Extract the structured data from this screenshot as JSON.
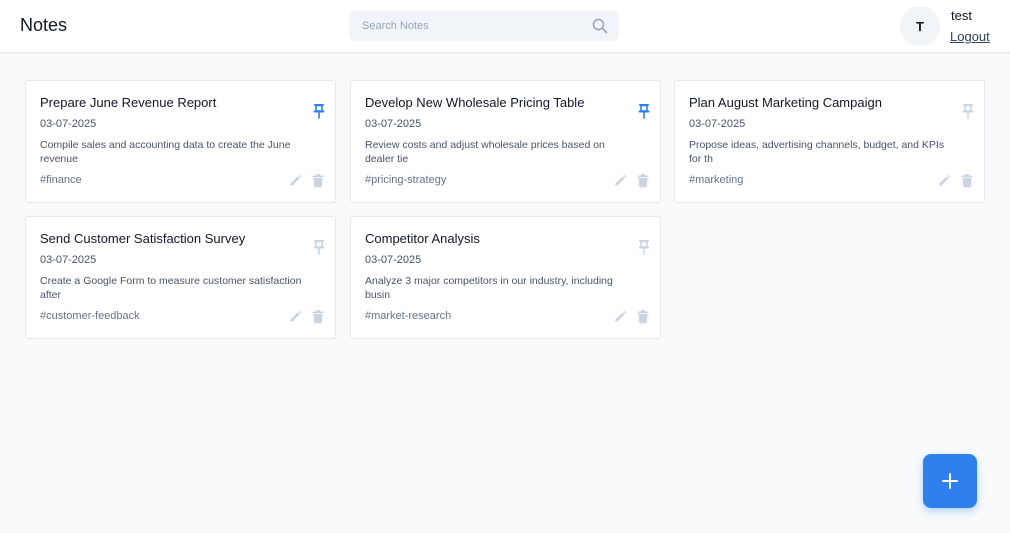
{
  "header": {
    "title": "Notes",
    "search_placeholder": "Search Notes",
    "avatar_initial": "T",
    "username": "test",
    "logout_label": "Logout"
  },
  "colors": {
    "accent": "#2f80ed",
    "pin_active": "#2f80ed",
    "pin_inactive": "#cbd5e1",
    "action_icon": "#cbd5e1"
  },
  "notes": [
    {
      "title": "Prepare June Revenue Report",
      "date": "03-07-2025",
      "content": "Compile sales and accounting data to create the June revenue",
      "tag": "#finance",
      "pinned": true
    },
    {
      "title": "Develop New Wholesale Pricing Table",
      "date": "03-07-2025",
      "content": "Review costs and adjust wholesale prices based on dealer tie",
      "tag": "#pricing-strategy",
      "pinned": true
    },
    {
      "title": "Plan August Marketing Campaign",
      "date": "03-07-2025",
      "content": "Propose ideas, advertising channels, budget, and KPIs for th",
      "tag": "#marketing",
      "pinned": false
    },
    {
      "title": "Send Customer Satisfaction Survey",
      "date": "03-07-2025",
      "content": "Create a Google Form to measure customer satisfaction after",
      "tag": "#customer-feedback",
      "pinned": false
    },
    {
      "title": "Competitor Analysis",
      "date": "03-07-2025",
      "content": "Analyze 3 major competitors in our industry, including busin",
      "tag": "#market-research",
      "pinned": false
    }
  ],
  "fab": {
    "icon": "plus-icon"
  }
}
